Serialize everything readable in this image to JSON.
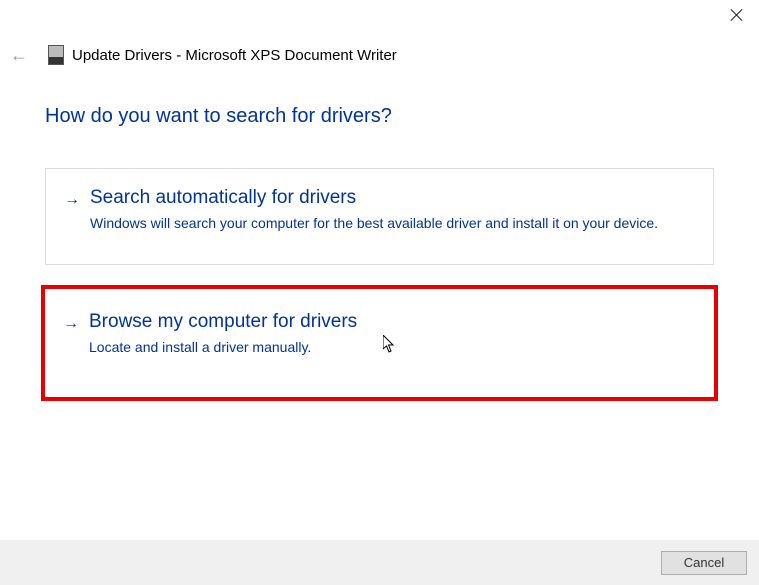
{
  "window_title": "Update Drivers - Microsoft XPS Document Writer",
  "heading": "How do you want to search for drivers?",
  "options": [
    {
      "title": "Search automatically for drivers",
      "desc": "Windows will search your computer for the best available driver and install it on your device."
    },
    {
      "title": "Browse my computer for drivers",
      "desc": "Locate and install a driver manually."
    }
  ],
  "footer": {
    "cancel": "Cancel"
  }
}
